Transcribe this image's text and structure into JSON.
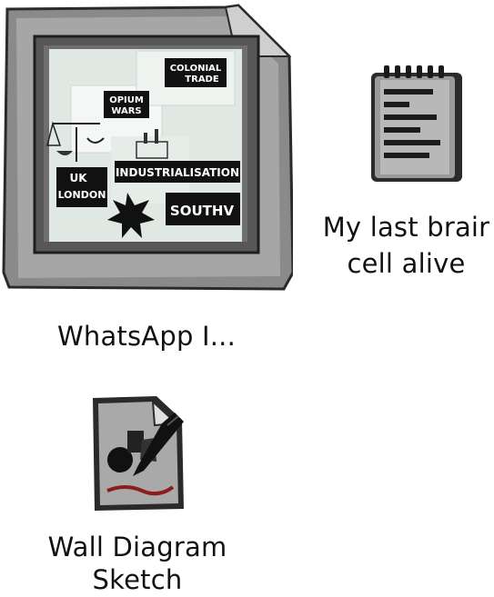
{
  "desktop": {
    "icons": [
      {
        "label": "WhatsApp I...",
        "thumbnail_texts": [
          "COLONIAL TRADE",
          "OPIUM WARS",
          "INDUSTRIALISATION",
          "UK LONDON",
          "SOUTHV"
        ]
      },
      {
        "label_line1": "My last brair",
        "label_line2": "cell alive"
      },
      {
        "label_line1": "Wall Diagram",
        "label_line2": "Sketch"
      }
    ]
  }
}
